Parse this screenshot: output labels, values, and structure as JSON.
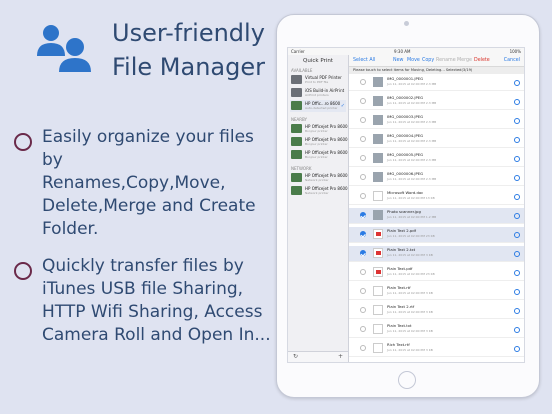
{
  "promo": {
    "headline": [
      "User-friendly",
      "File Manager"
    ],
    "features": [
      [
        "Easily organize your files by",
        "Renames,Copy,Move,",
        "Delete,Merge and Create",
        "Folder."
      ],
      [
        "Quickly transfer files by",
        "iTunes USB file Sharing,",
        "HTTP Wifi Sharing, Access",
        "Camera Roll and Open In..."
      ]
    ]
  },
  "status_bar": {
    "carrier": "Carrier",
    "time": "9:30 AM",
    "battery": "100%"
  },
  "sidebar": {
    "title": "Quick Print",
    "sections": {
      "available": "AVAILABLE",
      "nearby": "NEARBY",
      "network": "NETWORK"
    },
    "printers": [
      {
        "name": "Virtual PDF Printer",
        "sub": "Print to PDF file",
        "selected": false,
        "icon": "printer-icon"
      },
      {
        "name": "iOS Build-in AirPrint",
        "sub": "AirPrint printers",
        "selected": false,
        "icon": "printer-icon"
      },
      {
        "name": "HP Offic...ro 8600",
        "sub": "Auto-detected printer",
        "selected": true,
        "icon": "hp-printer-icon"
      },
      {
        "name": "HP Officejet Pro 8600",
        "sub": "Bonjour printer",
        "selected": false,
        "icon": "hp-printer-icon"
      },
      {
        "name": "HP Officejet Pro 8600",
        "sub": "Bonjour printer",
        "selected": false,
        "icon": "hp-printer-icon"
      },
      {
        "name": "HP Officejet Pro 8600",
        "sub": "Bonjour printer",
        "selected": false,
        "icon": "hp-printer-icon"
      },
      {
        "name": "HP Officejet Pro 8600",
        "sub": "Network printer",
        "selected": false,
        "icon": "hp-printer-icon"
      },
      {
        "name": "HP Officejet Pro 8600",
        "sub": "Network printer",
        "selected": false,
        "icon": "hp-printer-icon"
      }
    ],
    "footer": {
      "refresh": "↻",
      "add": "+"
    }
  },
  "toolbar": {
    "select_all": "Select All",
    "actions": [
      {
        "label": "New",
        "color": "#2b7be4"
      },
      {
        "label": "Move",
        "color": "#2b7be4"
      },
      {
        "label": "Copy",
        "color": "#2b7be4"
      },
      {
        "label": "Rename",
        "color": "#b0b0b0"
      },
      {
        "label": "Merge",
        "color": "#b0b0b0"
      },
      {
        "label": "Delete",
        "color": "#d9342b"
      }
    ],
    "cancel": "Cancel"
  },
  "hint": "Please touch to select items for Moving, Deleting... Selected(3/19)",
  "files": [
    {
      "name": "IMG_0000001.JPEG",
      "meta": "Jun 11, 2015 at 02:00 PM  2.3 MB",
      "kind": "photo",
      "selected": false
    },
    {
      "name": "IMG_0000002.JPEG",
      "meta": "Jun 11, 2015 at 02:00 PM  2.3 MB",
      "kind": "photo",
      "selected": false
    },
    {
      "name": "IMG_0000003.JPEG",
      "meta": "Jun 11, 2015 at 02:00 PM  2.3 MB",
      "kind": "photo",
      "selected": false
    },
    {
      "name": "IMG_0000004.JPEG",
      "meta": "Jun 11, 2015 at 02:00 PM  2.3 MB",
      "kind": "photo",
      "selected": false
    },
    {
      "name": "IMG_0000005.JPEG",
      "meta": "Jun 11, 2015 at 02:00 PM  2.3 MB",
      "kind": "photo",
      "selected": false
    },
    {
      "name": "IMG_0000006.JPEG",
      "meta": "Jun 11, 2015 at 02:00 PM  2.3 MB",
      "kind": "photo",
      "selected": false
    },
    {
      "name": "Microsoft Word.doc",
      "meta": "Jun 11, 2015 at 02:00 PM  13 KB",
      "kind": "doc",
      "selected": false
    },
    {
      "name": "Photo scanner.jpg",
      "meta": "Jun 11, 2015 at 02:00 PM  1.2 MB",
      "kind": "photo",
      "selected": true
    },
    {
      "name": "Plain Text 2.pdf",
      "meta": "Jun 11, 2015 at 02:00 PM  23 KB",
      "kind": "pdf",
      "selected": true
    },
    {
      "name": "Plain Text 2.txt",
      "meta": "Jun 11, 2015 at 02:00 PM  3 KB",
      "kind": "pdf",
      "selected": true
    },
    {
      "name": "Plain Text.pdf",
      "meta": "Jun 11, 2015 at 02:00 PM  23 KB",
      "kind": "pdf",
      "selected": false
    },
    {
      "name": "Plain Text.rtf",
      "meta": "Jun 11, 2015 at 02:00 PM  3 KB",
      "kind": "doc",
      "selected": false
    },
    {
      "name": "Plain Text 2.rtf",
      "meta": "Jun 11, 2015 at 02:00 PM  3 KB",
      "kind": "doc",
      "selected": false
    },
    {
      "name": "Plain Text.txt",
      "meta": "Jun 11, 2015 at 02:00 PM  3 KB",
      "kind": "doc",
      "selected": false
    },
    {
      "name": "Rich Text.rtf",
      "meta": "Jun 11, 2015 at 02:00 PM  3 KB",
      "kind": "doc",
      "selected": false
    }
  ]
}
